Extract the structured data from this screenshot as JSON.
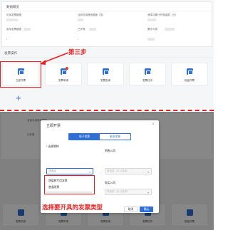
{
  "top": {
    "card_title": "数据概览",
    "stats_row1": [
      {
        "label": "可用发票额度"
      },
      {
        "label": "当前可用授信额度（张）"
      },
      {
        "label": "递本月累计开具金额（元）"
      }
    ],
    "stats_row2": [
      {
        "label": "实际发票额度"
      },
      {
        "label": "已开具"
      },
      {
        "label": "累计可用"
      }
    ],
    "stats_row3_value": "-",
    "section_title": "发票操作",
    "tiles": [
      "立即开票",
      "发票申请",
      "发票查询",
      "发票红冲",
      "批量开票"
    ],
    "step_label": "第三步",
    "add_symbol": "+"
  },
  "bottom": {
    "bg_label_1": "当前可用授信额度",
    "bg_label_2": "已开具",
    "bg_tiles": [
      "发票开具",
      "发票申请",
      "发票查询",
      "发票红冲",
      "批量开票"
    ]
  },
  "modal": {
    "title": "立即开票",
    "close_glyph": "×",
    "tabs": [
      {
        "label": "电子发票",
        "active": true
      },
      {
        "label": "纸质发票",
        "active": false
      }
    ],
    "invoice_type": {
      "required_mark": "*",
      "label": "选择票种",
      "placeholder": "请选择"
    },
    "seller": {
      "label": "销售公司",
      "placeholder": "请选择（可以选择）"
    },
    "buyer": {
      "label": "购买公司",
      "placeholder": "请选择（可以选择）"
    },
    "options": [
      "增值税专用发票",
      "普通发票"
    ],
    "cancel_label": "取消",
    "ok_label": "确认"
  },
  "instruction": "选择要开具的发票类型",
  "colors": {
    "accent": "#2f6fd6",
    "annotation_red": "#ee1c1c"
  }
}
